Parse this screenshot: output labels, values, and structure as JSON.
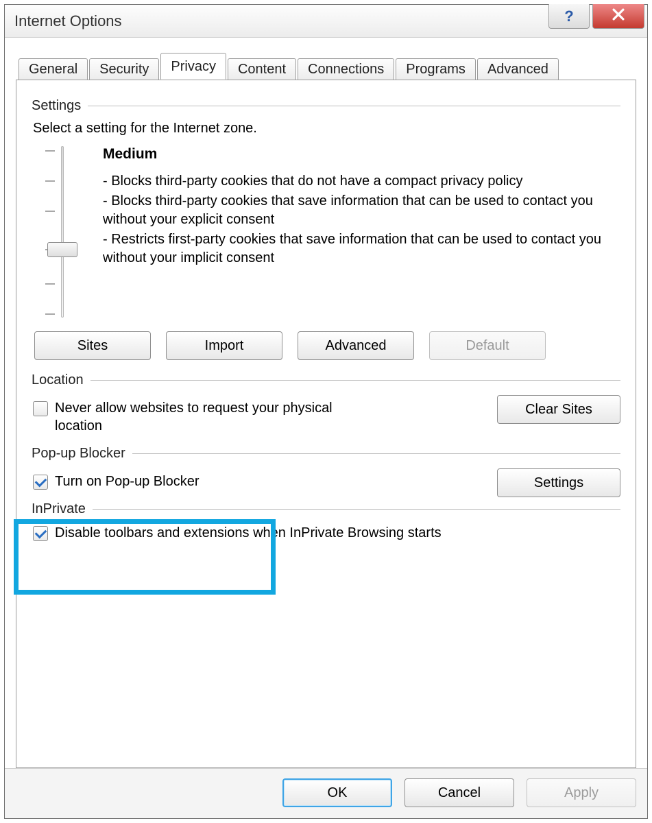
{
  "window": {
    "title": "Internet Options"
  },
  "tabs": {
    "items": [
      {
        "label": "General"
      },
      {
        "label": "Security"
      },
      {
        "label": "Privacy"
      },
      {
        "label": "Content"
      },
      {
        "label": "Connections"
      },
      {
        "label": "Programs"
      },
      {
        "label": "Advanced"
      }
    ],
    "active_index": 2
  },
  "privacy": {
    "settings_heading": "Settings",
    "settings_intro": "Select a setting for the Internet zone.",
    "level_name": "Medium",
    "bullets": [
      "- Blocks third-party cookies that do not have a compact privacy policy",
      "- Blocks third-party cookies that save information that can be used to contact you without your explicit consent",
      "- Restricts first-party cookies that save information that can be used to contact you without your implicit consent"
    ],
    "buttons": {
      "sites": "Sites",
      "import": "Import",
      "advanced": "Advanced",
      "default": "Default"
    },
    "location_heading": "Location",
    "location_checkbox": "Never allow websites to request your physical location",
    "location_checked": false,
    "clear_sites": "Clear Sites",
    "popup_heading": "Pop-up Blocker",
    "popup_checkbox": "Turn on Pop-up Blocker",
    "popup_checked": true,
    "popup_settings": "Settings",
    "inprivate_heading": "InPrivate",
    "inprivate_checkbox": "Disable toolbars and extensions when InPrivate Browsing starts",
    "inprivate_checked": true
  },
  "dialog_buttons": {
    "ok": "OK",
    "cancel": "Cancel",
    "apply": "Apply"
  }
}
